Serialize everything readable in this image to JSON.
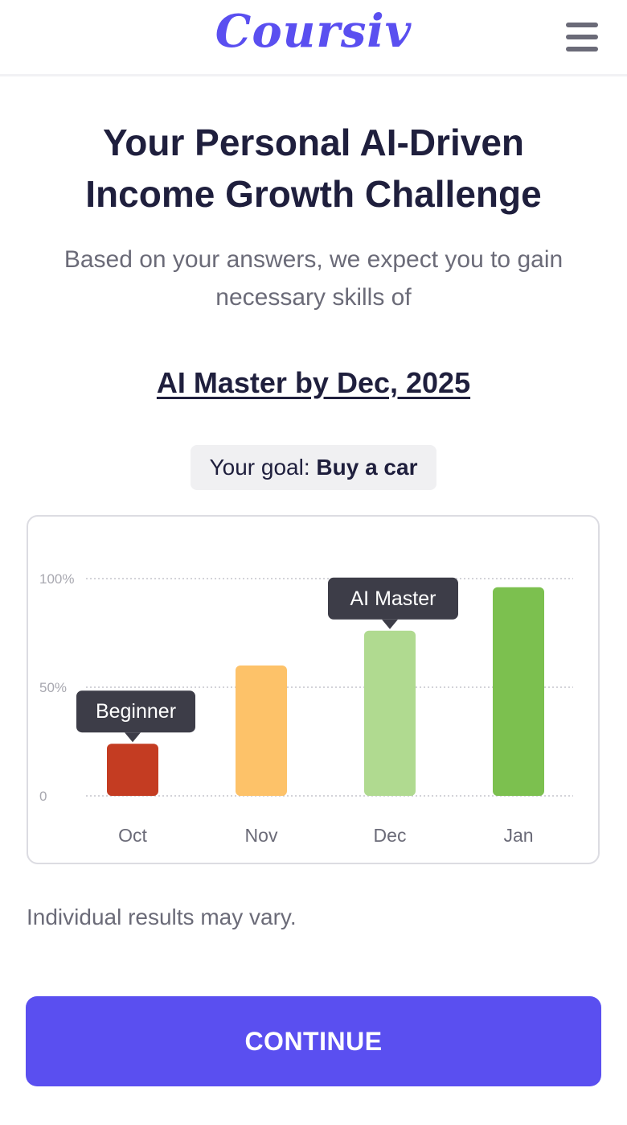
{
  "header": {
    "logo_text": "Coursiv",
    "menu_icon": "hamburger-menu-icon"
  },
  "hero": {
    "title_line1": "Your Personal AI-Driven",
    "title_line2": "Income Growth Challenge",
    "subtitle": "Based on your answers, we expect you to gain necessary skills of",
    "headline": "AI Master by Dec, 2025"
  },
  "goal": {
    "label": "Your goal:",
    "value": "Buy a car"
  },
  "chart_data": {
    "type": "bar",
    "categories": [
      "Oct",
      "Nov",
      "Dec",
      "Jan"
    ],
    "values": [
      24,
      60,
      76,
      96
    ],
    "colors": [
      "#c43c22",
      "#fdc269",
      "#b0da90",
      "#7cc04f"
    ],
    "ylim": [
      0,
      100
    ],
    "yticks": [
      {
        "value": 0,
        "label": "0"
      },
      {
        "value": 50,
        "label": "50%"
      },
      {
        "value": 100,
        "label": "100%"
      }
    ],
    "annotations": [
      {
        "category": "Oct",
        "text": "Beginner"
      },
      {
        "category": "Dec",
        "text": "AI Master"
      }
    ],
    "grid": true,
    "title": "",
    "xlabel": "",
    "ylabel": ""
  },
  "disclaimer": "Individual results may vary.",
  "cta": {
    "label": "CONTINUE"
  },
  "colors": {
    "accent": "#5a4ff0",
    "text_dark": "#1f1f3d",
    "text_muted": "#6b6b78"
  }
}
